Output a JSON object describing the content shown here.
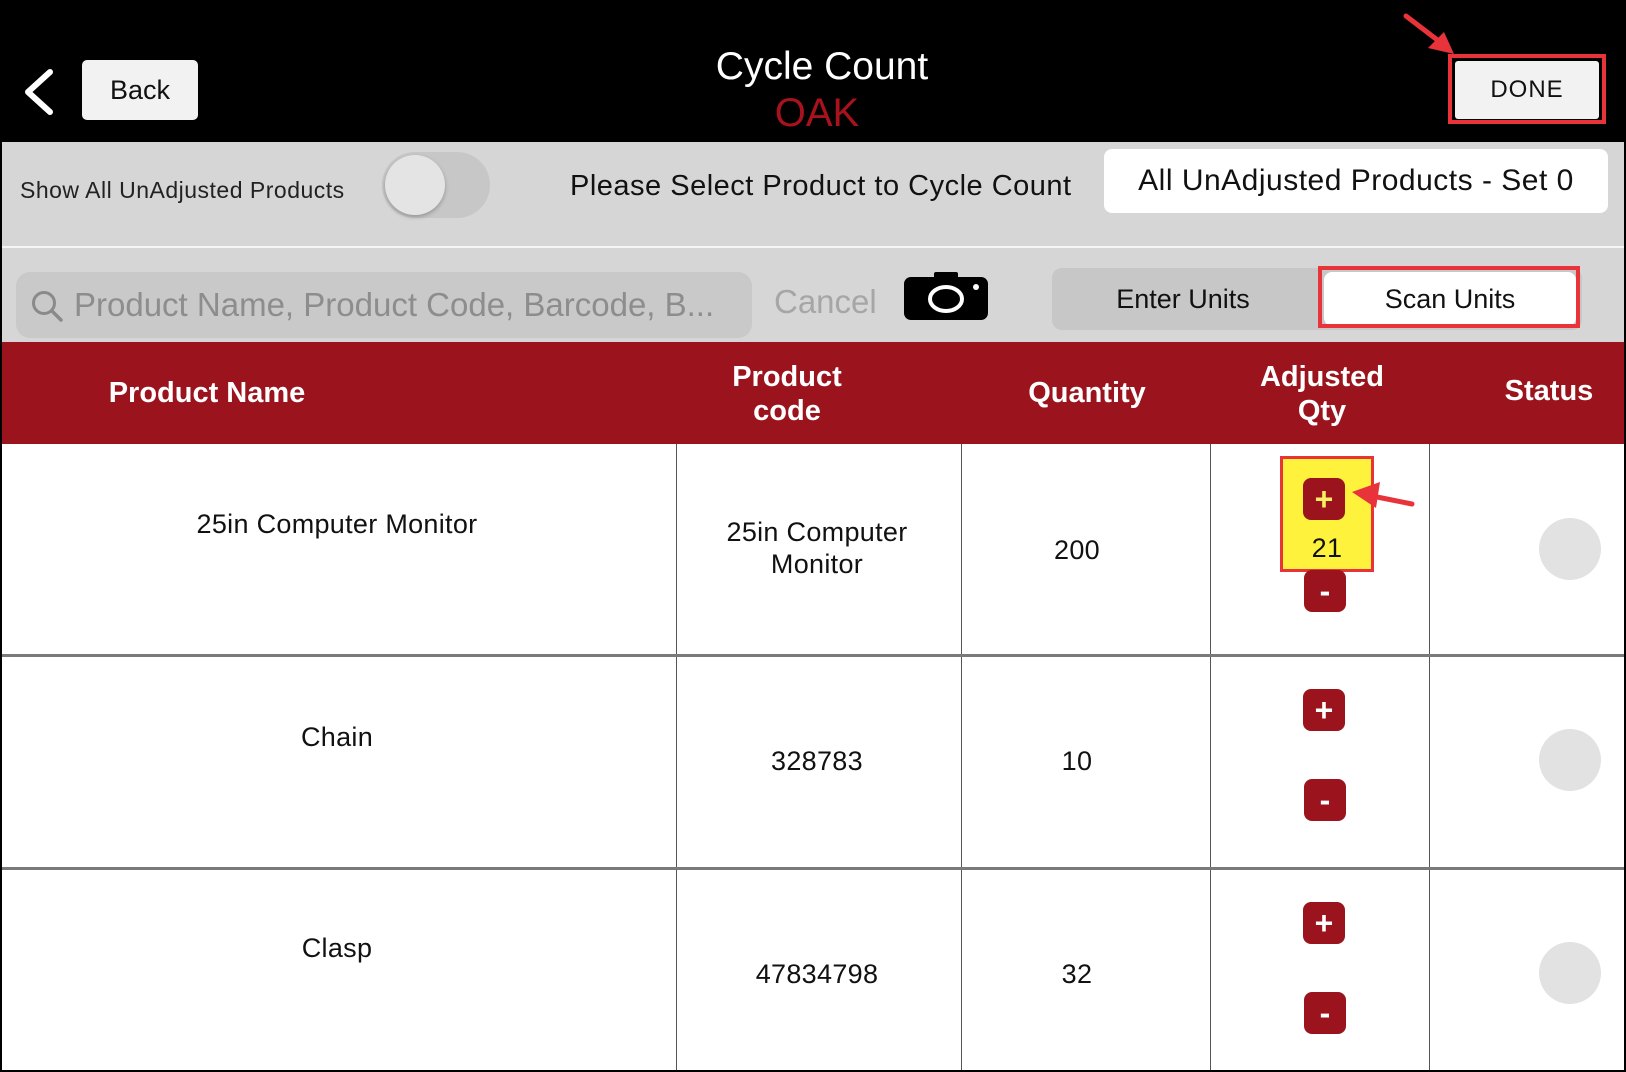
{
  "header": {
    "back_label": "Back",
    "title": "Cycle Count",
    "location": "OAK",
    "done_label": "DONE"
  },
  "filter": {
    "show_all_label": "Show All UnAdjusted Products",
    "toggle_on": false,
    "select_prompt": "Please Select Product to Cycle Count",
    "selected_set": "All UnAdjusted Products - Set 0"
  },
  "search": {
    "placeholder": "Product Name, Product Code, Barcode, B...",
    "cancel_label": "Cancel"
  },
  "mode": {
    "enter_units": "Enter Units",
    "scan_units": "Scan Units",
    "selected": "Scan Units"
  },
  "table": {
    "headers": {
      "product_name": "Product Name",
      "product_code_line1": "Product",
      "product_code_line2": "code",
      "quantity": "Quantity",
      "adjusted_qty_line1": "Adjusted",
      "adjusted_qty_line2": "Qty",
      "status": "Status"
    },
    "rows": [
      {
        "name": "25in Computer Monitor",
        "code_line1": "25in Computer",
        "code_line2": "Monitor",
        "quantity": "200",
        "adjusted": "21",
        "plus": "+",
        "minus": "-"
      },
      {
        "name": "Chain",
        "code_line1": "328783",
        "code_line2": "",
        "quantity": "10",
        "adjusted": "",
        "plus": "+",
        "minus": "-"
      },
      {
        "name": "Clasp",
        "code_line1": "47834798",
        "code_line2": "",
        "quantity": "32",
        "adjusted": "",
        "plus": "+",
        "minus": "-"
      }
    ]
  },
  "colors": {
    "brand_red": "#9b141d",
    "highlight_red": "#e8333a",
    "highlight_yellow": "#fff23d"
  },
  "icons": [
    "back-chevron-icon",
    "search-icon",
    "camera-icon",
    "plus-icon",
    "minus-icon",
    "status-circle-icon",
    "arrow-annotation-icon"
  ]
}
